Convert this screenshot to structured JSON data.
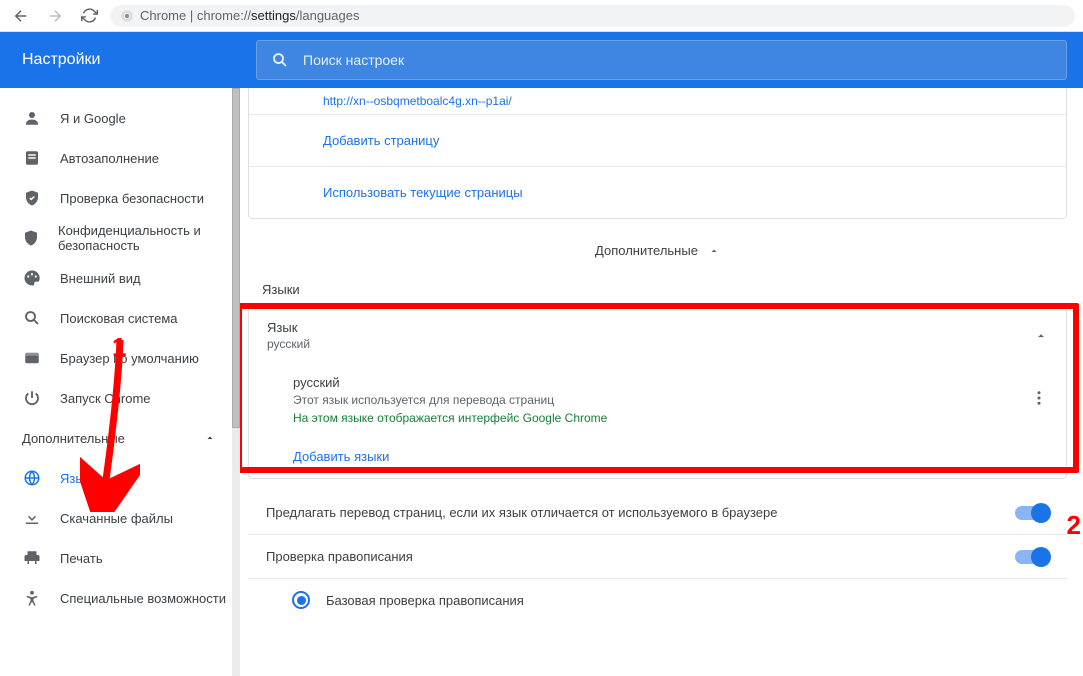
{
  "browser": {
    "url_label": "Chrome",
    "url_prefix": "chrome://",
    "url_mid": "settings",
    "url_suffix": "/languages"
  },
  "header": {
    "title": "Настройки"
  },
  "search": {
    "placeholder": "Поиск настроек"
  },
  "sidebar": {
    "items": [
      {
        "label": "Я и Google"
      },
      {
        "label": "Автозаполнение"
      },
      {
        "label": "Проверка безопасности"
      },
      {
        "label": "Конфиденциальность и безопасность"
      },
      {
        "label": "Внешний вид"
      },
      {
        "label": "Поисковая система"
      },
      {
        "label": "Браузер по умолчанию"
      },
      {
        "label": "Запуск Chrome"
      }
    ],
    "section": "Дополнительные",
    "adv_items": [
      {
        "label": "Языки"
      },
      {
        "label": "Скачанные файлы"
      },
      {
        "label": "Печать"
      },
      {
        "label": "Специальные возможности"
      }
    ]
  },
  "pages": {
    "url_hint": "http://xn--osbqmetboalc4g.xn--p1ai/",
    "add_page": "Добавить страницу",
    "use_current": "Использовать текущие страницы"
  },
  "advanced_label": "Дополнительные",
  "languages": {
    "section": "Языки",
    "header": "Язык",
    "header_sub": "русский",
    "item": "русский",
    "item_sub": "Этот язык используется для перевода страниц",
    "item_green": "На этом языке отображается интерфейс Google Chrome",
    "add": "Добавить языки"
  },
  "options": {
    "translate": "Предлагать перевод страниц, если их язык отличается от используемого в браузере",
    "spellcheck": "Проверка правописания",
    "basic": "Базовая проверка правописания"
  },
  "annotations": {
    "num1": "1",
    "num2": "2"
  }
}
